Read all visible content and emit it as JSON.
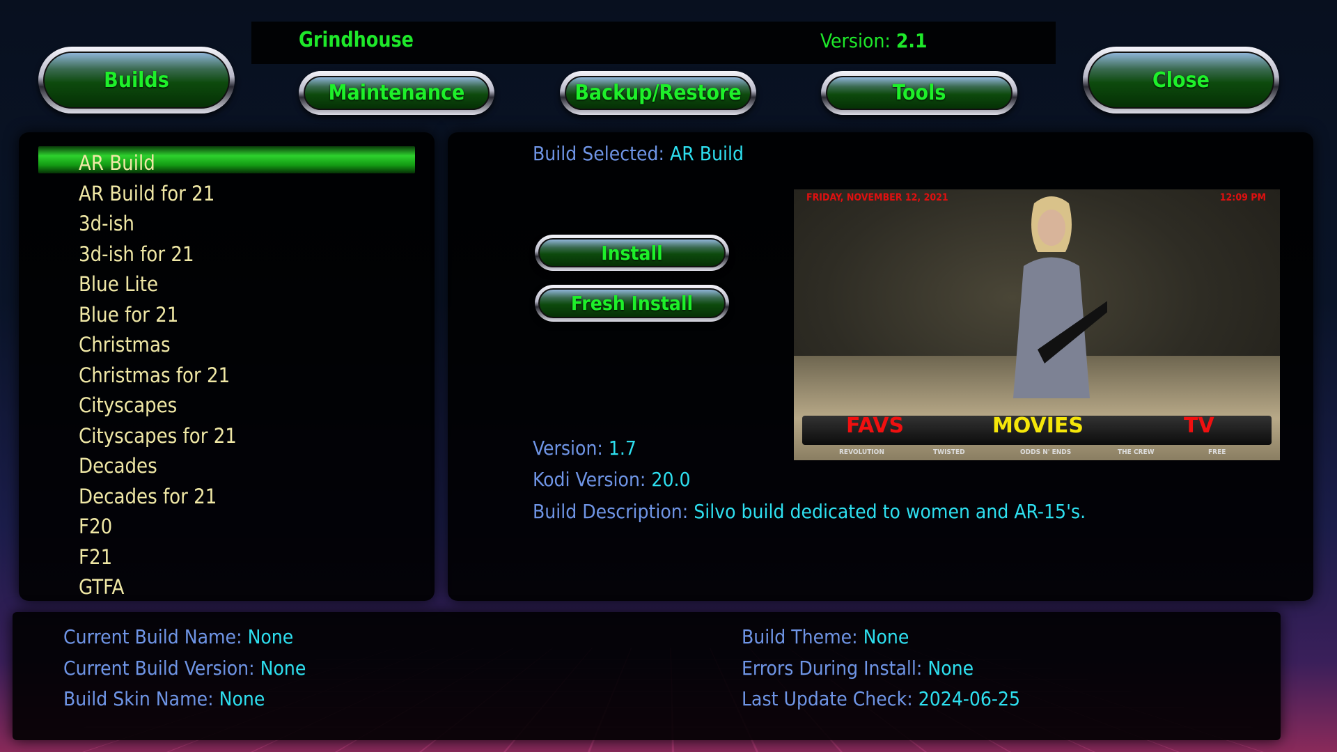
{
  "header": {
    "title": "Grindhouse",
    "version_label": "Version:",
    "version_value": "2.1"
  },
  "nav": {
    "builds": "Builds",
    "maintenance": "Maintenance",
    "backup": "Backup/Restore",
    "tools": "Tools",
    "close": "Close"
  },
  "builds_list": {
    "selected_index": 0,
    "items": [
      "AR Build",
      "AR Build for 21",
      "3d-ish",
      "3d-ish for 21",
      "Blue Lite",
      "Blue for 21",
      "Christmas",
      "Christmas for 21",
      "Cityscapes",
      "Cityscapes for 21",
      "Decades",
      "Decades for 21",
      "F20",
      "F21",
      "GTFA"
    ]
  },
  "details": {
    "selected_label": "Build Selected:",
    "selected_value": "AR Build",
    "install": "Install",
    "fresh_install": "Fresh Install",
    "version_label": "Version:",
    "version_value": "1.7",
    "kodi_label": "Kodi Version:",
    "kodi_value": "20.0",
    "desc_label": "Build Description:",
    "desc_value": "Silvo build dedicated to women and AR-15's.",
    "preview": {
      "date": "FRIDAY, NOVEMBER 12, 2021",
      "time": "12:09 PM",
      "menu": [
        "FAVS",
        "MOVIES",
        "TV"
      ],
      "submenu": [
        "REVOLUTION",
        "TWISTED",
        "ODDS N' ENDS",
        "THE CREW",
        "FREE"
      ]
    }
  },
  "status": {
    "current_build_name_label": "Current Build Name:",
    "current_build_name": "None",
    "current_build_version_label": "Current Build Version:",
    "current_build_version": "None",
    "build_skin_label": "Build Skin Name:",
    "build_skin": "None",
    "build_theme_label": "Build Theme:",
    "build_theme": "None",
    "errors_label": "Errors During Install:",
    "errors": "None",
    "last_update_label": "Last Update Check:",
    "last_update": "2024-06-25"
  },
  "colors": {
    "accent_green": "#1ee82a",
    "label_blue": "#6f95e6",
    "value_cyan": "#2ee0f0",
    "list_text": "#f0e8a6"
  }
}
